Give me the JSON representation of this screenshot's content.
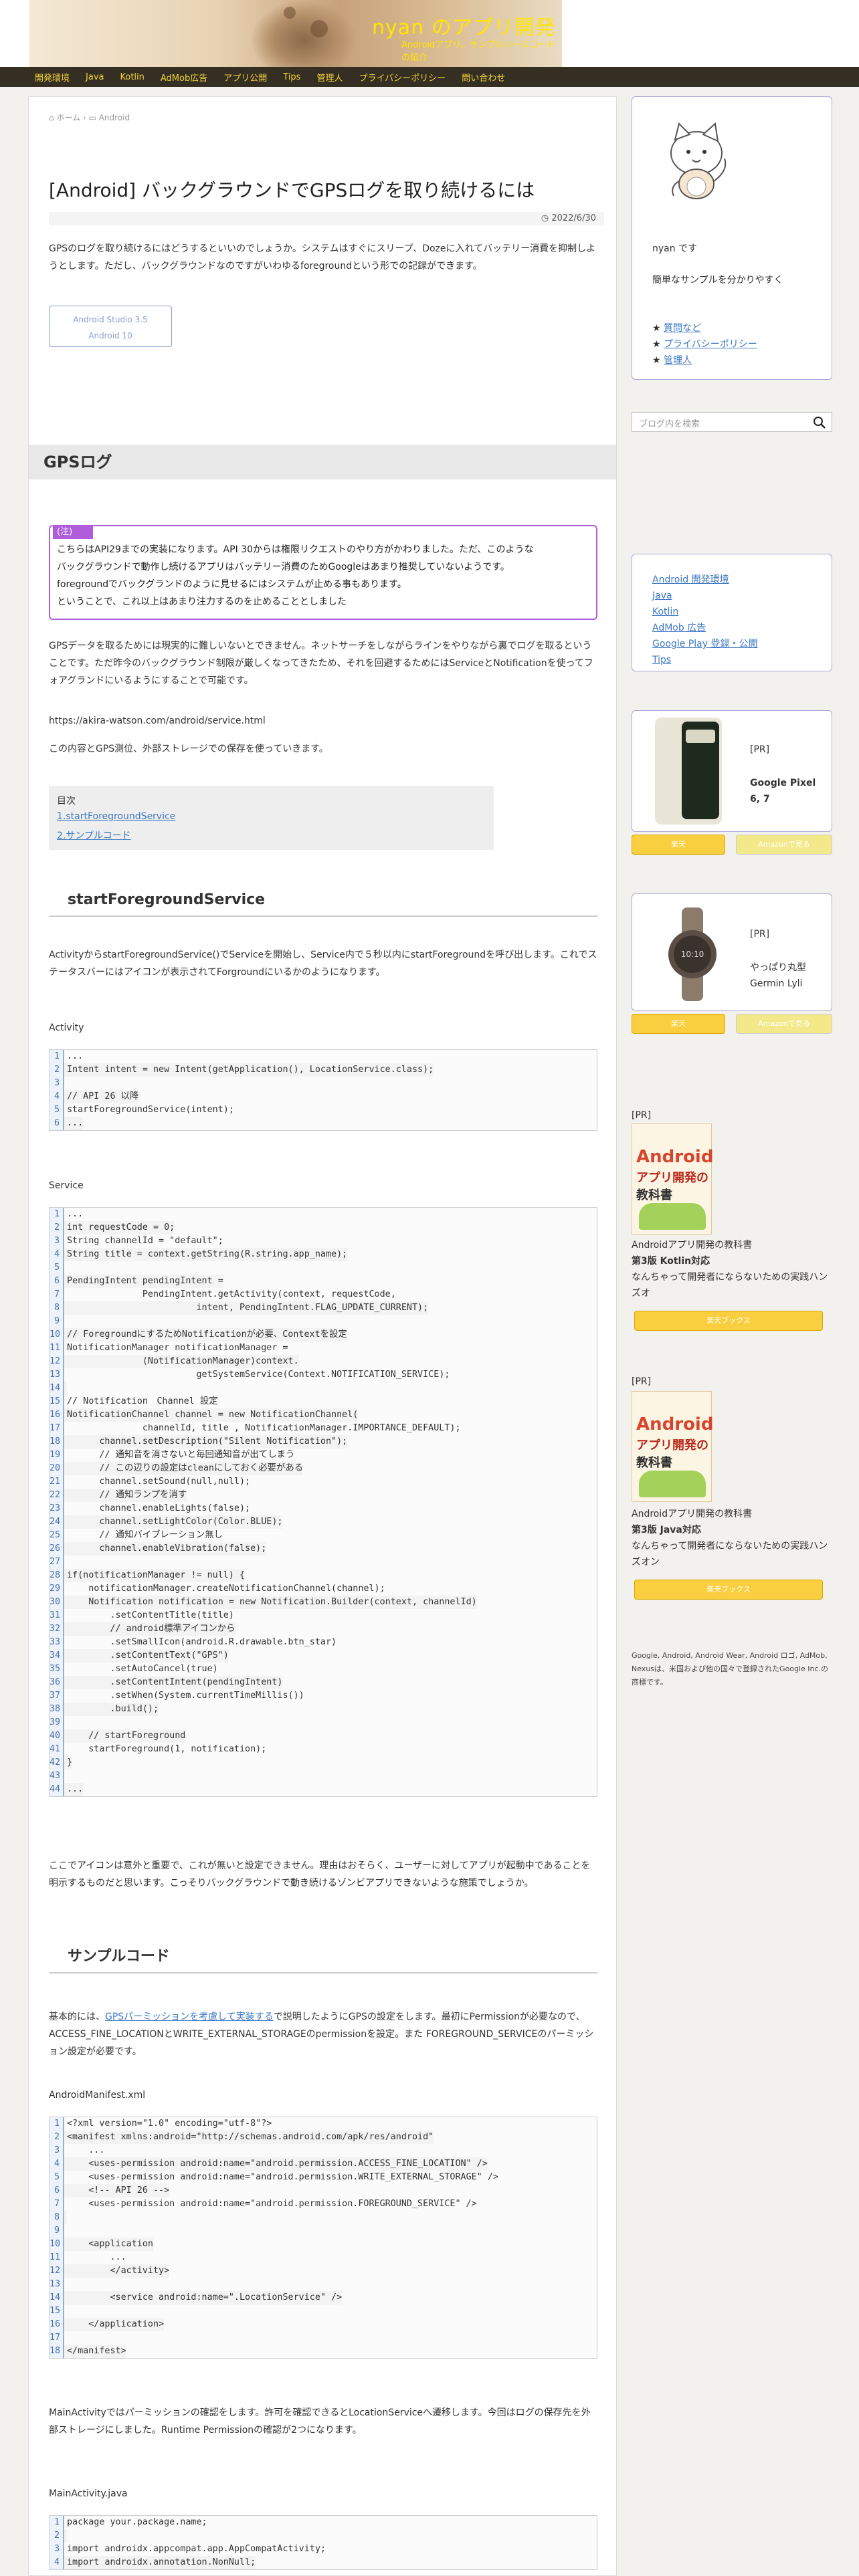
{
  "header": {
    "site_title": "nyan のアプリ開発",
    "site_subtitle": "Androidアプリ、サンプルソースコードの紹介"
  },
  "nav": {
    "items": [
      "開発環境",
      "Java",
      "Kotlin",
      "AdMob広告",
      "アプリ公開",
      "Tips",
      "管理人",
      "プライバシーポリシー",
      "問い合わせ"
    ]
  },
  "breadcrumb": {
    "home": "ホーム",
    "category": "Android"
  },
  "post": {
    "title": "[Android] バックグラウンドでGPSログを取り続けるには",
    "date": "2022/6/30",
    "intro": "GPSのログを取り続けるにはどうするといいのでしょうか。システムはすぐにスリープ、Dozeに入れてバッテリー消費を抑制しようとします。ただし、バックグラウンドなのですがいわゆるforegroundという形での記録ができます。",
    "tags": [
      "Android Studio 3.5",
      "Android 10"
    ],
    "h2": "GPSログ",
    "note_label": "(注)",
    "note_lines": [
      "こちらはAPI29までの実装になります。API 30からは権限リクエストのやり方がかわりました。ただ、このような",
      "バックグラウンドで動作し続けるアプリはバッテリー消費のためGoogleはあまり推奨していないようです。",
      "foregroundでバックグランドのように見せるにはシステムが止める事もあります。",
      "ということで、これ以上はあまり注力するのを止めることとしました"
    ],
    "para1": "GPSデータを取るためには現実的に難しいないとできません。ネットサーチをしながらラインをやりながら裏でログを取るということです。ただ昨今のバックグラウンド制限が厳しくなってきたため、それを回避するためにはServiceとNotificationを使ってフォアグランドにいるようにすることで可能です。",
    "url": "https://akira-watson.com/android/service.html",
    "para2": "この内容とGPS測位、外部ストレージでの保存を使っていきます。",
    "toc": {
      "title": "目次",
      "items": [
        "1.startForegroundService",
        "2.サンプルコード"
      ]
    },
    "h3_1": "startForegroundService",
    "para3": "ActivityからstartForegroundService()でServiceを開始し、Service内で５秒以内にstartForegroundを呼び出します。これでステータスバーにはアイコンが表示されてForgroundにいるかのようになります。",
    "label_activity": "Activity",
    "code_activity": [
      "...",
      "Intent intent = new Intent(getApplication(), LocationService.class);",
      "",
      "// API 26 以降",
      "startForegroundService(intent);",
      "..."
    ],
    "label_service": "Service",
    "code_service": [
      "...",
      "int requestCode = 0;",
      "String channelId = \"default\";",
      "String title = context.getString(R.string.app_name);",
      "",
      "PendingIntent pendingIntent =",
      "              PendingIntent.getActivity(context, requestCode,",
      "                        intent, PendingIntent.FLAG_UPDATE_CURRENT);",
      "",
      "// ForegroundにするためNotificationが必要、Contextを設定",
      "NotificationManager notificationManager =",
      "              (NotificationManager)context.",
      "                        getSystemService(Context.NOTIFICATION_SERVICE);",
      "",
      "// Notification　Channel 設定",
      "NotificationChannel channel = new NotificationChannel(",
      "              channelId, title , NotificationManager.IMPORTANCE_DEFAULT);",
      "      channel.setDescription(\"Silent Notification\");",
      "      // 通知音を消さないと毎回通知音が出てしまう",
      "      // この辺りの設定はcleanにしておく必要がある",
      "      channel.setSound(null,null);",
      "      // 通知ランプを消す",
      "      channel.enableLights(false);",
      "      channel.setLightColor(Color.BLUE);",
      "      // 通知バイブレーション無し",
      "      channel.enableVibration(false);",
      "",
      "if(notificationManager != null) {",
      "    notificationManager.createNotificationChannel(channel);",
      "    Notification notification = new Notification.Builder(context, channelId)",
      "        .setContentTitle(title)",
      "        // android標準アイコンから",
      "        .setSmallIcon(android.R.drawable.btn_star)",
      "        .setContentText(\"GPS\")",
      "        .setAutoCancel(true)",
      "        .setContentIntent(pendingIntent)",
      "        .setWhen(System.currentTimeMillis())",
      "        .build();",
      "",
      "    // startForeground",
      "    startForeground(1, notification);",
      "}",
      "",
      "..."
    ],
    "para4": "ここでアイコンは意外と重要で、これが無いと設定できません。理由はおそらく、ユーザーに対してアプリが起動中であることを明示するものだと思います。こっそりバックグラウンドで動き続けるゾンビアプリできないような施策でしょうか。",
    "h3_2": "サンプルコード",
    "para5_a": "基本的には、",
    "para5_link": "GPSパーミッションを考慮して実装する",
    "para5_b": "で説明したようにGPSの設定をします。最初にPermissionが必要なので、ACCESS_FINE_LOCATIONとWRITE_EXTERNAL_STORAGEのpermissionを設定。また FOREGROUND_SERVICEのパーミッション設定が必要です。",
    "label_manifest": "AndroidManifest.xml",
    "code_manifest": [
      "<?xml version=\"1.0\" encoding=\"utf-8\"?>",
      "<manifest xmlns:android=\"http://schemas.android.com/apk/res/android\"",
      "    ...",
      "    <uses-permission android:name=\"android.permission.ACCESS_FINE_LOCATION\" />",
      "    <uses-permission android:name=\"android.permission.WRITE_EXTERNAL_STORAGE\" />",
      "    <!-- API 26 -->",
      "    <uses-permission android:name=\"android.permission.FOREGROUND_SERVICE\" />",
      "",
      "",
      "    <application",
      "        ...",
      "        </activity>",
      "",
      "        <service android:name=\".LocationService\" />",
      "",
      "    </application>",
      "",
      "</manifest>"
    ],
    "para6": "MainActivityではパーミッションの確認をします。許可を確認できるとLocationServiceへ遷移します。今回はログの保存先を外部ストレージにしました。Runtime Permissionの確認が2つになります。",
    "label_main": "MainActivity.java",
    "code_main": [
      "package your.package.name;",
      "",
      "import androidx.appcompat.app.AppCompatActivity;",
      "import androidx.annotation.NonNull;"
    ]
  },
  "sidebar": {
    "profile_name": "nyan です",
    "profile_desc": "簡単なサンプルを分かりやすく",
    "profile_links": [
      "質問など",
      "プライバシーポリシー",
      "管理人"
    ],
    "search_placeholder": "ブログ内を検索",
    "categories": [
      "Android 開発環境",
      "Java",
      "Kotlin",
      "AdMob 広告",
      "Google Play 登録・公開",
      "Tips"
    ],
    "pr1": {
      "tag": "[PR]",
      "name": "Google Pixel 6, 7",
      "btn1": "楽天",
      "btn2": "Amazonで見る"
    },
    "pr2": {
      "tag": "[PR]",
      "name": "やっぱり丸型 Germin Lyli",
      "btn1": "楽天",
      "btn2": "Amazonで見る"
    },
    "book1": {
      "tag": "[PR]",
      "cover1": "Android",
      "cover2": "アプリ開発の",
      "cover3": "教科書",
      "l1": "Androidアプリ開発の教科書",
      "l2": "第3版 Kotlin対応",
      "l3": "なんちゃって開発者にならないための実践ハンズオ",
      "btn": "楽天ブックス"
    },
    "book2": {
      "tag": "[PR]",
      "cover1": "Android",
      "cover2": "アプリ開発の",
      "cover3": "教科書",
      "l1": "Androidアプリ開発の教科書",
      "l2": "第3版 Java対応",
      "l3": "なんちゃって開発者にならないための実践ハンズオン",
      "btn": "楽天ブックス"
    },
    "footer_note": "Google, Android, Android Wear, Android ロゴ, AdMob, Nexusは、米国および他の国々で登録されたGoogle Inc.の商標です。"
  },
  "colors": {
    "accent": "#ffe600",
    "nav_bg": "#342f22",
    "note_border": "#b15ddb",
    "link": "#3b78c3"
  }
}
